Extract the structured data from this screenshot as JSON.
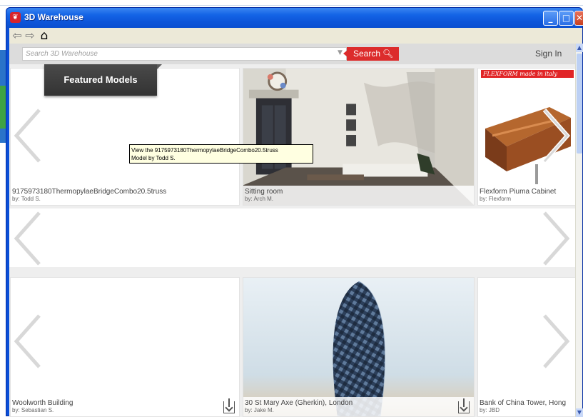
{
  "window": {
    "title": "3D Warehouse"
  },
  "search": {
    "placeholder": "Search 3D Warehouse",
    "button_label": "Search",
    "signin_label": "Sign In"
  },
  "featured_label": "Featured Models",
  "tooltip": {
    "line1": "View the 9175973180ThermopylaeBridgeCombo20.5truss",
    "line2": "Model by Todd S."
  },
  "rows": [
    {
      "cards": [
        {
          "title": "9175973180ThermopylaeBridgeCombo20.5truss",
          "by": "by: Todd S."
        },
        {
          "title": "Sitting room",
          "by": "by: Arch M."
        },
        {
          "title": "Flexform Piuma Cabinet",
          "by": "by: Flexform",
          "logo_text": "FLEXFORM   made in italy"
        }
      ]
    },
    {
      "cards": [
        {
          "title": "Woolworth Building",
          "by": "by: Sebastian S."
        },
        {
          "title": "30 St Mary Axe (Gherkin), London",
          "by": "by: Jake M."
        },
        {
          "title": "Bank of China Tower, Hong",
          "by": "by: JBD"
        }
      ]
    }
  ],
  "colors": {
    "titlebar": "#0d55d9",
    "search_button": "#dc2c2c",
    "featured_bg": "#3a3a3a"
  }
}
